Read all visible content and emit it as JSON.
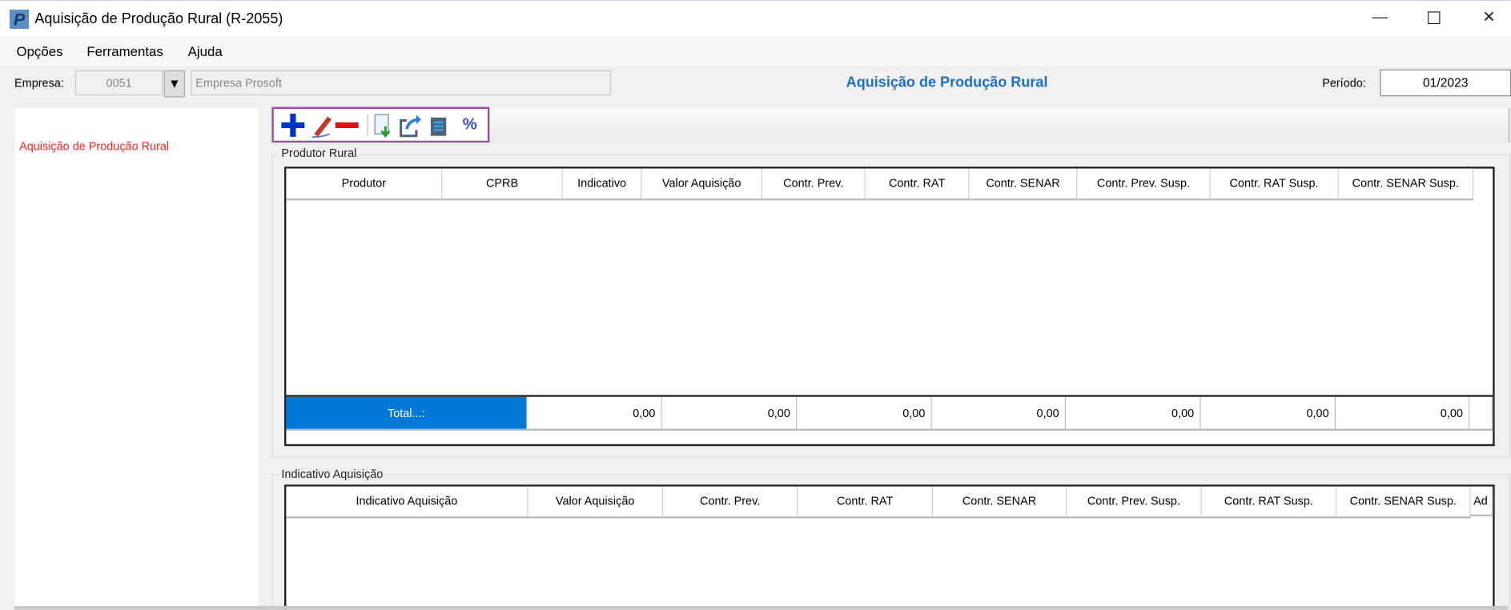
{
  "window": {
    "title": "Aquisição de Produção Rural (R-2055)",
    "app_icon": "P",
    "minimize": "—",
    "maximize": "☐",
    "close": "✕"
  },
  "menu": [
    "Opções",
    "Ferramentas",
    "Ajuda"
  ],
  "header": {
    "empresa_label": "Empresa:",
    "empresa_code": "0051",
    "dropdown_icon": "▼",
    "empresa_name": "Empresa Prosoft",
    "page_title": "Aquisição de Produção Rural",
    "periodo_label": "Período:",
    "periodo_value": "01/2023"
  },
  "sidebar": {
    "items": [
      "Aquisição de Produção Rural"
    ]
  },
  "toolbar": {
    "icons": [
      "add-icon",
      "edit-icon",
      "remove-icon",
      "import-icon",
      "export-icon",
      "report-icon",
      "percent-icon"
    ],
    "percent": "%"
  },
  "produtor_rural": {
    "title": "Produtor Rural",
    "columns": [
      "Produtor",
      "CPRB",
      "Indicativo",
      "Valor Aquisição",
      "Contr. Prev.",
      "Contr. RAT",
      "Contr. SENAR",
      "Contr. Prev. Susp.",
      "Contr. RAT Susp.",
      "Contr. SENAR Susp."
    ],
    "total_label": "Total...:",
    "totals": [
      "0,00",
      "0,00",
      "0,00",
      "0,00",
      "0,00",
      "0,00",
      "0,00"
    ]
  },
  "indicativo_aquisicao": {
    "title": "Indicativo Aquisição",
    "columns": [
      "Indicativo Aquisição",
      "Valor Aquisição",
      "Contr. Prev.",
      "Contr. RAT",
      "Contr. SENAR",
      "Contr. Prev. Susp.",
      "Contr. RAT Susp.",
      "Contr. SENAR Susp.",
      "Ad"
    ]
  },
  "colors": {
    "accent": "#0078d7",
    "title_blue": "#1a6fc9",
    "sidebar_red": "#ff2020",
    "highlight": "#9b4fa6"
  }
}
